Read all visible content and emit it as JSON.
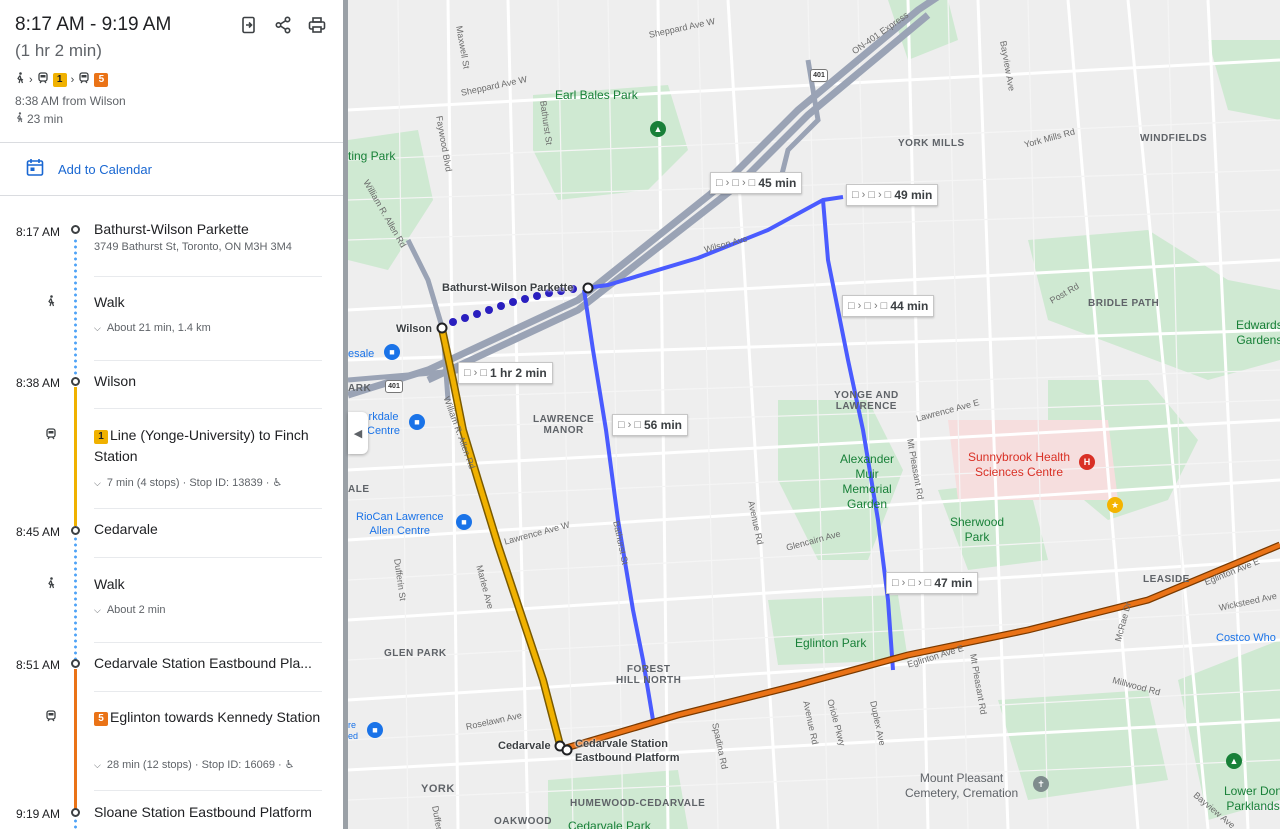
{
  "trip": {
    "time_range": "8:17 AM - 9:19 AM",
    "duration": "(1 hr 2 min)",
    "steps": {
      "line1": "1",
      "line5": "5"
    },
    "departure": "8:38 AM from Wilson",
    "walk_total": "23 min",
    "add_calendar": "Add to Calendar"
  },
  "timeline": {
    "start": {
      "time": "8:17 AM",
      "name": "Bathurst-Wilson Parkette",
      "address": "3749 Bathurst St, Toronto, ON M3H 3M4"
    },
    "walk1": {
      "label": "Walk",
      "detail": "About 21 min, 1.4 km"
    },
    "wilson": {
      "time": "8:38 AM",
      "name": "Wilson"
    },
    "leg1": {
      "badge": "1",
      "title": "Line (Yonge-University) to Finch Station",
      "detail": "7 min (4 stops) · Stop ID: 13839 ·"
    },
    "cedarvale": {
      "time": "8:45 AM",
      "name": "Cedarvale"
    },
    "walk2": {
      "label": "Walk",
      "detail": "About 2 min"
    },
    "cedarvale_plat": {
      "time": "8:51 AM",
      "name": "Cedarvale Station Eastbound Pla..."
    },
    "leg5": {
      "badge": "5",
      "title": "Eglinton towards Kennedy Station",
      "detail": "28 min (12 stops) · Stop ID: 16069 ·"
    },
    "sloane": {
      "time": "9:19 AM",
      "name": "Sloane Station Eastbound Platform"
    }
  },
  "map": {
    "route_labels": {
      "r45": "45 min",
      "r49": "49 min",
      "r44": "44 min",
      "r1h2": "1 hr 2 min",
      "r56": "56 min",
      "r47": "47 min"
    },
    "stops": {
      "parkette": "Bathurst-Wilson Parkette",
      "wilson": "Wilson",
      "cedarvale": "Cedarvale",
      "cedarvale_station": "Cedarvale Station\nEastbound Platform"
    },
    "neighborhoods": {
      "york_mills": "YORK MILLS",
      "windfields": "WINDFIELDS",
      "bridle_path": "BRIDLE PATH",
      "yonge_lawrence": "YONGE AND\nLAWRENCE",
      "lawrence_manor": "LAWRENCE\nMANOR",
      "leaside": "LEASIDE",
      "glen_park": "GLEN PARK",
      "forest_hill": "FOREST\nHILL NORTH",
      "york": "YORK",
      "humewood": "HUMEWOOD-CEDARVALE",
      "oakwood": "OAKWOOD"
    },
    "parks": {
      "earl_bales": "Earl Bales Park",
      "alexander_muir": "Alexander\nMuir\nMemorial\nGarden",
      "sherwood": "Sherwood\nPark",
      "eglinton_park": "Eglinton Park",
      "cedarvale_park": "Cedarvale Park",
      "ting_park": "ting Park",
      "edwards": "Edwards\nGardens",
      "lower_don": "Lower Don\nParklands",
      "mount_pleasant": "Mount Pleasant\nCemetery, Cremation"
    },
    "pois": {
      "sunnybrook": "Sunnybrook Health\nSciences Centre",
      "riocan": "RioCan Lawrence\nAllen Centre",
      "yorkdale": "rkdale\nCentre",
      "esale": "esale",
      "costco": "Costco Who",
      "ark": "ARK",
      "ale": "ALE",
      "re": "re\ned"
    },
    "streets": {
      "sheppard1": "Sheppard Ave W",
      "sheppard2": "Sheppard Ave W",
      "hwy401": "ON-401 Express",
      "maxwell": "Maxwell St",
      "faywood": "Faywood Blvd",
      "bathurst_n": "Bathurst St",
      "bathurst_s": "Bathurst St",
      "william_allen_n": "William R. Allen Rd",
      "william_allen_s": "William R. Allen Rd",
      "wilson_ave": "Wilson Ave",
      "bayview_n": "Bayview Ave",
      "york_mills_rd": "York Mills Rd",
      "post_rd": "Post Rd",
      "lawrence_e": "Lawrence Ave E",
      "lawrence_w": "Lawrence Ave W",
      "mt_pleasant1": "Mt Pleasant Rd",
      "mt_pleasant2": "Mt Pleasant Rd",
      "avenue_rd1": "Avenue Rd",
      "avenue_rd2": "Avenue Rd",
      "glencairn": "Glencairn Ave",
      "dufferin": "Dufferin St",
      "marlee": "Marlee Ave",
      "eglinton_e1": "Eglinton Ave E",
      "eglinton_e2": "Eglinton Ave E",
      "wicksteed": "Wicksteed Ave",
      "mcrae": "McRae Dr",
      "millwood": "Millwood Rd",
      "oriole": "Oriole Pkwy",
      "duplex": "Duplex Ave",
      "spadina": "Spadina Rd",
      "roselawn": "Roselawn Ave",
      "bayview_s": "Bayview Ave",
      "duffer": "Duffer"
    },
    "shields": {
      "s401a": "401",
      "s401b": "401"
    }
  },
  "colors": {
    "walk": "#4fa3f7",
    "line1": "#f0b100",
    "line5": "#ea7317",
    "alt_route": "#4a5bff",
    "walk_map": "#2a1fbf"
  }
}
